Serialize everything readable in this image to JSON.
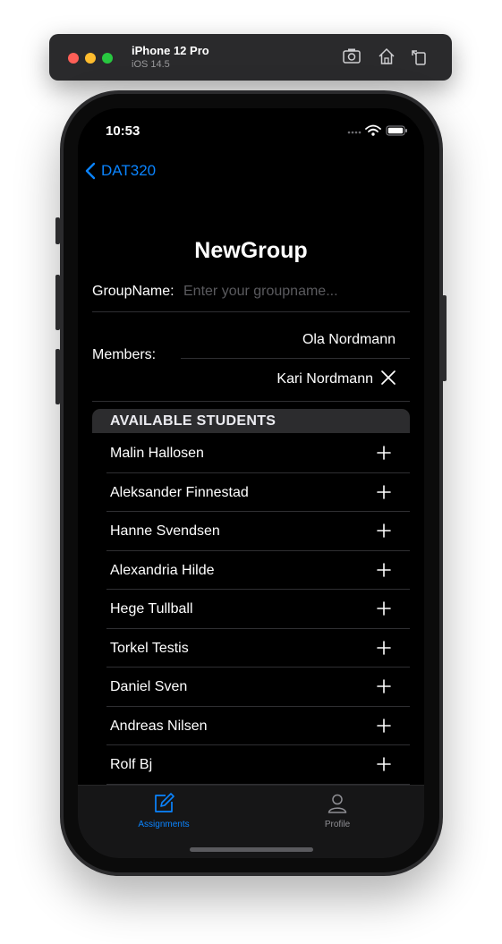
{
  "simulator": {
    "device": "iPhone 12 Pro",
    "os": "iOS 14.5",
    "buttons": [
      "screenshot-icon",
      "home-icon",
      "rotate-icon"
    ]
  },
  "status_bar": {
    "time": "10:53"
  },
  "nav": {
    "back_label": "DAT320"
  },
  "page": {
    "title": "NewGroup"
  },
  "group_name": {
    "label": "GroupName:",
    "placeholder": "Enter your groupname..."
  },
  "members": {
    "label": "Members:",
    "items": [
      {
        "name": "Ola Nordmann"
      },
      {
        "name": "Kari Nordmann"
      }
    ]
  },
  "available": {
    "header": "AVAILABLE STUDENTS",
    "students": [
      "Malin Hallosen",
      "Aleksander Finnestad",
      "Hanne Svendsen",
      "Alexandria Hilde",
      "Hege Tullball",
      "Torkel Testis",
      "Daniel Sven",
      "Andreas Nilsen",
      "Rolf Bj"
    ]
  },
  "tab_bar": {
    "tabs": [
      {
        "label": "Assignments",
        "icon": "edit-icon",
        "active": true
      },
      {
        "label": "Profile",
        "icon": "person-icon",
        "active": false
      }
    ]
  },
  "colors": {
    "accent": "#0a84ff",
    "background": "#000000",
    "section": "#2c2c2e"
  }
}
